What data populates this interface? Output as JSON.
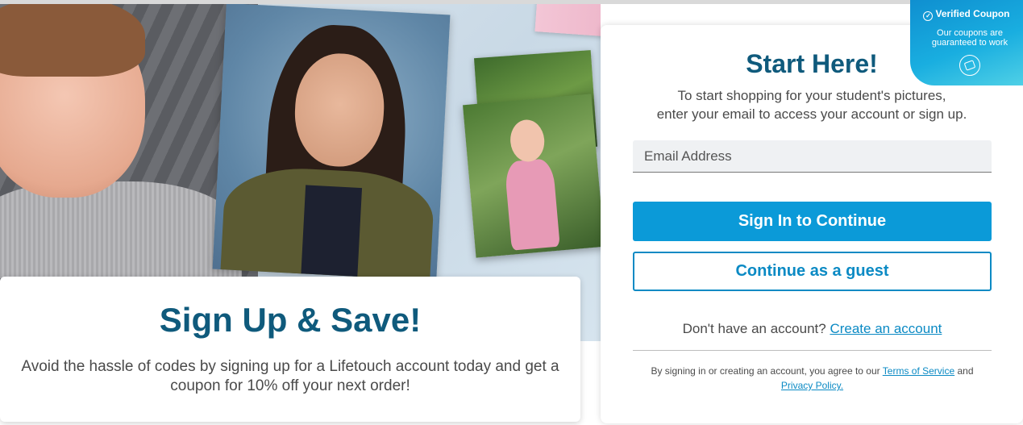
{
  "promo": {
    "title": "Sign Up & Save!",
    "text": "Avoid the hassle of codes by signing up for a Lifetouch account today and get a coupon for 10% off your next order!"
  },
  "signin": {
    "title": "Start Here!",
    "subtitle_line1": "To start shopping for your student's pictures,",
    "subtitle_line2": "enter your email to access your account or sign up.",
    "email_placeholder": "Email Address",
    "sign_in_button": "Sign In to Continue",
    "guest_button": "Continue as a guest",
    "no_account_text": "Don't have an account?",
    "create_account_link": "Create an account",
    "legal_prefix": "By signing in or creating an account, you agree to our",
    "terms_link": "Terms of Service",
    "legal_and": "and",
    "privacy_link": "Privacy Policy."
  },
  "coupon_badge": {
    "title": "Verified Coupon",
    "line1": "Our coupons are",
    "line2": "guaranteed to work",
    "icon": "coupon-tag-icon"
  },
  "colors": {
    "brand_blue": "#0b9ad8",
    "heading_blue": "#0f5a7c",
    "link_blue": "#0b8ac4"
  }
}
